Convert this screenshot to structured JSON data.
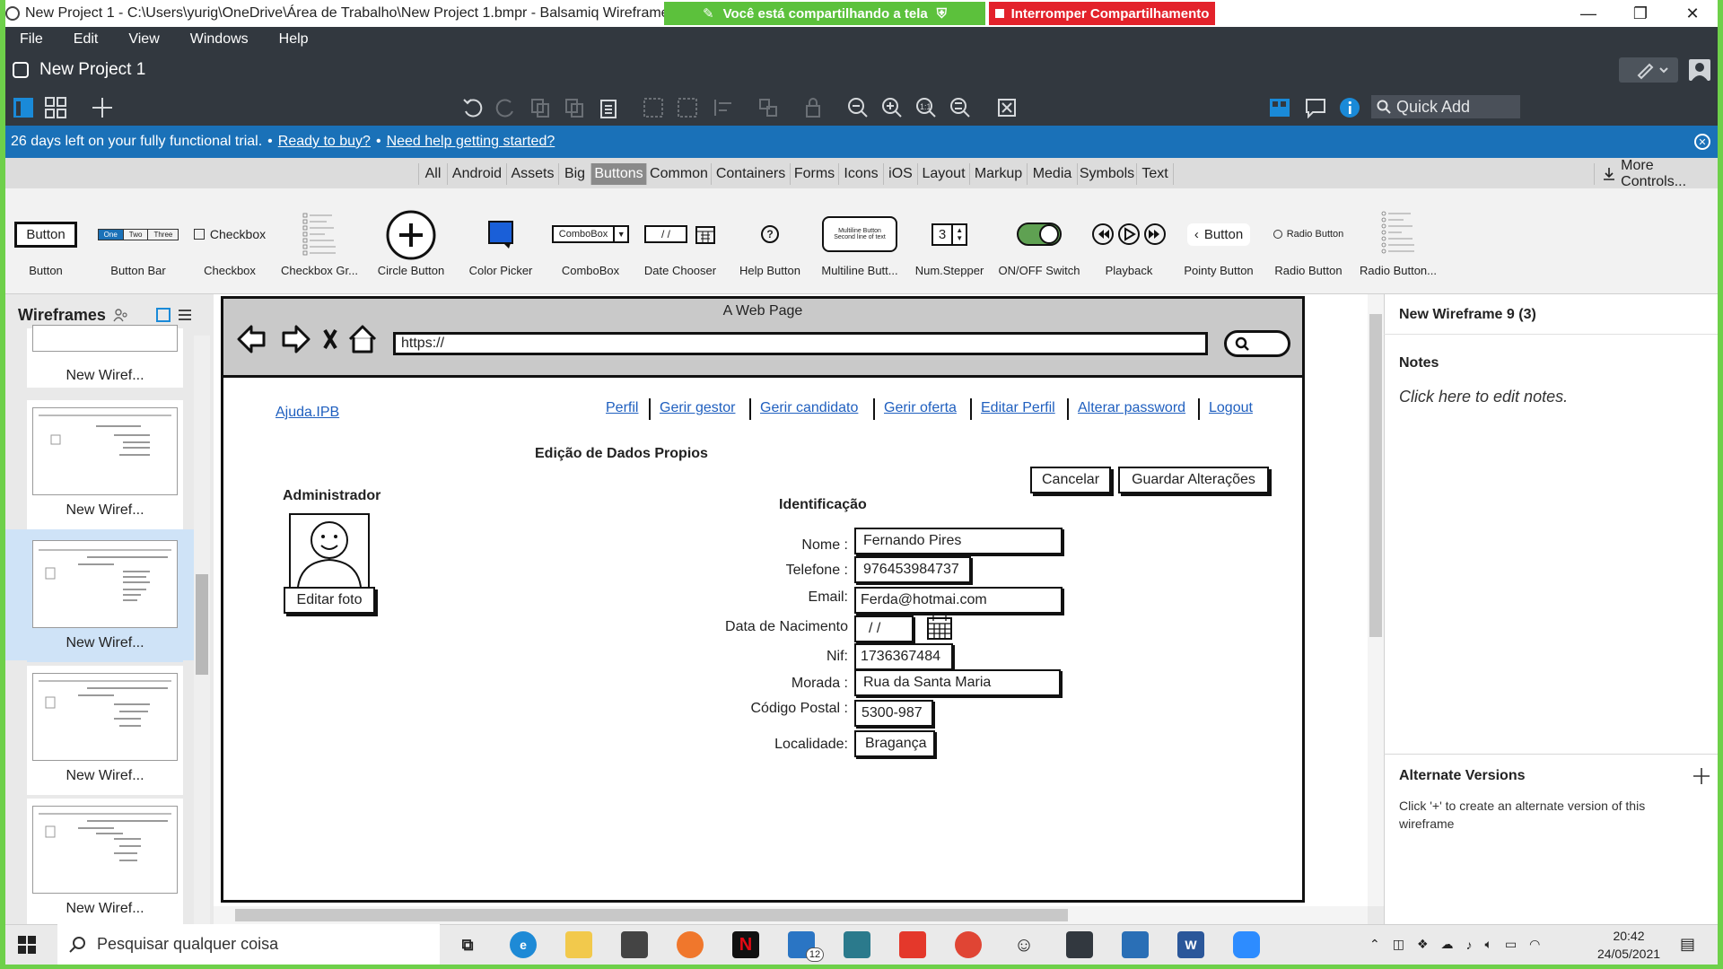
{
  "window": {
    "title": "New Project 1 - C:\\Users\\yurig\\OneDrive\\Área de Trabalho\\New Project 1.bmpr - Balsamiq Wireframes",
    "share_notice": "Você está compartilhando a tela",
    "stop_share": "Interromper Compartilhamento"
  },
  "menu": [
    "File",
    "Edit",
    "View",
    "Windows",
    "Help"
  ],
  "project": {
    "name": "New Project 1"
  },
  "quick_add": "Quick Add",
  "trial": {
    "text": "26 days left on your fully functional trial.",
    "bullet": "•",
    "link_buy": "Ready to buy?",
    "link_help": "Need help getting started?"
  },
  "categories": [
    "All",
    "Android",
    "Assets",
    "Big",
    "Buttons",
    "Common",
    "Containers",
    "Forms",
    "Icons",
    "iOS",
    "Layout",
    "Markup",
    "Media",
    "Symbols",
    "Text"
  ],
  "active_category": "Buttons",
  "more_controls": "More Controls...",
  "library": {
    "items": [
      "Button",
      "Button Bar",
      "Checkbox",
      "Checkbox Gr...",
      "Circle Button",
      "Color Picker",
      "ComboBox",
      "Date Chooser",
      "Help Button",
      "Multiline Butt...",
      "Num.Stepper",
      "ON/OFF Switch",
      "Playback",
      "Pointy Button",
      "Radio Button",
      "Radio Button..."
    ],
    "previews": {
      "button": "Button",
      "buttonbar": [
        "One",
        "Two",
        "Three"
      ],
      "checkbox": "Checkbox",
      "combobox": "ComboBox",
      "date": "/ /",
      "multiline": [
        "Multiline Button",
        "Second line of text"
      ],
      "stepper": "3",
      "pointy": "Button",
      "radio": "Radio Button"
    }
  },
  "wireframes_panel": {
    "title": "Wireframes",
    "thumbs": [
      "New Wiref...",
      "New Wiref...",
      "New Wiref...",
      "New Wiref...",
      "New Wiref..."
    ],
    "selected_index": 2
  },
  "mock": {
    "browser_title": "A Web Page",
    "url": "https://",
    "site_link": "Ajuda.IPB",
    "nav": [
      "Perfil",
      "Gerir gestor",
      "Gerir candidato",
      "Gerir oferta",
      "Editar Perfil",
      "Alterar password",
      "Logout"
    ],
    "page_heading": "Edição de Dados Propios",
    "admin_label": "Administrador",
    "edit_photo": "Editar foto",
    "cancel": "Cancelar",
    "save": "Guardar Alterações",
    "section": "Identificação",
    "fields": [
      {
        "label": "Nome :",
        "value": "Fernando Pires"
      },
      {
        "label": "Telefone :",
        "value": "976453984737"
      },
      {
        "label": "Email:",
        "value": "Ferda@hotmai.com"
      },
      {
        "label": "Data de Nacimento",
        "value": "/ /"
      },
      {
        "label": "Nif:",
        "value": "1736367484"
      },
      {
        "label": "Morada :",
        "value": "Rua da Santa Maria"
      },
      {
        "label": "Código Postal :",
        "value": "5300-987"
      },
      {
        "label": "Localidade:",
        "value": "Bragança"
      }
    ]
  },
  "right_panel": {
    "title": "New Wireframe 9 (3)",
    "notes_title": "Notes",
    "notes_placeholder": "Click here to edit notes.",
    "alt_title": "Alternate Versions",
    "alt_text": "Click '+' to create an alternate version of this wireframe"
  },
  "taskbar": {
    "search_placeholder": "Pesquisar qualquer coisa",
    "mail_badge": "12",
    "time": "20:42",
    "date": "24/05/2021"
  },
  "colors": {
    "header": "#32383f",
    "trial": "#1a71b8",
    "share_green": "#5cc13c",
    "stop_red": "#e3222b",
    "link_blue": "#1f5fbf"
  }
}
